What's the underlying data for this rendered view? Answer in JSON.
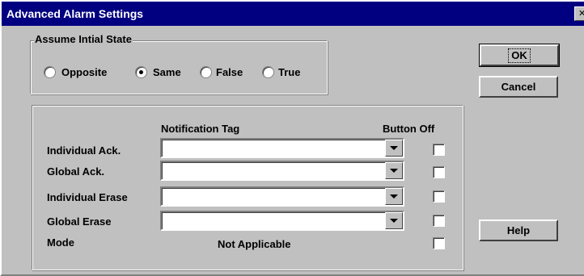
{
  "window": {
    "title": "Advanced Alarm Settings",
    "close_glyph": "✕"
  },
  "initial_state": {
    "legend": "Assume Intial State",
    "options": [
      {
        "label": "Opposite",
        "selected": false
      },
      {
        "label": "Same",
        "selected": true
      },
      {
        "label": "False",
        "selected": false
      },
      {
        "label": "True",
        "selected": false
      }
    ]
  },
  "buttons": {
    "ok": "OK",
    "cancel": "Cancel",
    "help": "Help"
  },
  "notification": {
    "col_tag": "Notification Tag",
    "col_button_off": "Button Off",
    "rows": [
      {
        "label": "Individual Ack.",
        "value": "",
        "button_off": false
      },
      {
        "label": "Global Ack.",
        "value": "",
        "button_off": false
      },
      {
        "label": "Individual Erase",
        "value": "",
        "button_off": false
      },
      {
        "label": "Global Erase",
        "value": "",
        "button_off": false
      }
    ],
    "mode": {
      "label": "Mode",
      "value": "Not Applicable",
      "button_off": false
    }
  }
}
